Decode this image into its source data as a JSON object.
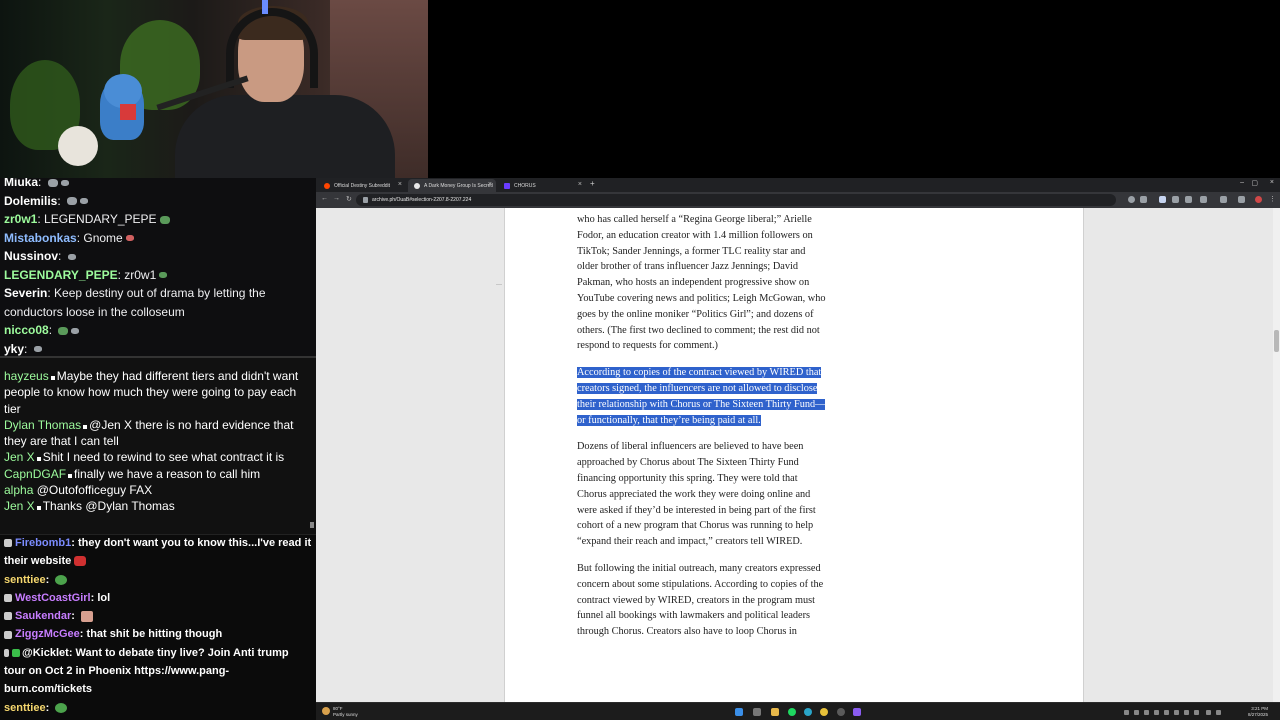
{
  "chat_top": [
    {
      "user": "Miuka",
      "text": "",
      "color": "#ffffff"
    },
    {
      "user": "Dolemilis",
      "text": "",
      "color": "#ffffff"
    },
    {
      "user": "zr0w1",
      "text": "LEGENDARY_PEPE",
      "color": "#9dfc9d"
    },
    {
      "user": "Mistabonkas",
      "text": "Gnome",
      "color": "#8fbcff"
    },
    {
      "user": "Nussinov",
      "text": "",
      "color": "#ffffff"
    },
    {
      "user": "LEGENDARY_PEPE",
      "text": "zr0w1",
      "color": "#9dfc9d"
    },
    {
      "user": "Severin",
      "text": "Keep destiny out of drama by letting the conductors loose in the colloseum",
      "color": "#ffffff"
    },
    {
      "user": "nicco08",
      "text": "",
      "color": "#9dfc9d"
    },
    {
      "user": "yky",
      "text": "",
      "color": "#ffffff"
    }
  ],
  "chat_mid": [
    {
      "user": "hayzeus",
      "text": "Maybe they had different tiers and didn't want people to know how much they were going to pay each tier",
      "color": "#9dfc9d"
    },
    {
      "user": "Dylan Thomas",
      "text": "@Jen X there is no hard evidence that they are that I can tell",
      "color": "#9dfc9d"
    },
    {
      "user": "Jen X",
      "text": "Shit I need to rewind to see what contract it is",
      "color": "#9dfc9d"
    },
    {
      "user": "CapnDGAF",
      "text": "finally we have a reason to call him",
      "color": "#9dfc9d"
    },
    {
      "user": "alpha",
      "text": "@Outofofficeguy FAX",
      "color": "#9dfc9d"
    },
    {
      "user": "Jen X",
      "text": "Thanks @Dylan Thomas",
      "color": "#9dfc9d"
    }
  ],
  "chat_bot": [
    {
      "user": "Firebomb1",
      "text": "they don't want you to know this...I've read it their website",
      "color": "#7b8cff"
    },
    {
      "user": "senttiee",
      "text": "",
      "color": "#f5d76e"
    },
    {
      "user": "WestCoastGirl",
      "text": "lol",
      "color": "#c77dff"
    },
    {
      "user": "Saukendar",
      "text": "",
      "color": "#c77dff"
    },
    {
      "user": "ZiggzMcGee",
      "text": "that shit be hitting though",
      "color": "#c77dff"
    },
    {
      "user": "@Kicklet",
      "text": "Want to debate tiny live? Join Anti trump tour on Oct 2 in Phoenix https://www.pang-burn.com/tickets",
      "color": "#ffffff"
    },
    {
      "user": "senttiee",
      "text": "",
      "color": "#f5d76e"
    }
  ],
  "browser": {
    "tabs": [
      {
        "label": "Official Destiny Subreddit",
        "color": "#ff4500"
      },
      {
        "label": "A Dark Money Group Is Secretl",
        "color": "#e8e8e8"
      },
      {
        "label": "CHORUS",
        "color": "#6a3cff"
      }
    ],
    "url": "archive.ph/OuaB#selection-2207.8-2207.224",
    "article": [
      {
        "text": "who has called herself a “Regina George liberal;” Arielle Fodor, an education creator with 1.4 million followers on TikTok; Sander Jennings, a former TLC reality star and older brother of trans influencer Jazz Jennings; David Pakman, who hosts an independent progressive show on YouTube covering news and politics; Leigh McGowan, who goes by the online moniker “Politics Girl”; and dozens of others. (The first two declined to comment; the rest did not respond to requests for comment.)",
        "highlighted": false
      },
      {
        "text": "According to copies of the contract viewed by WIRED that creators signed, the influencers are not allowed to disclose their relationship with Chorus or The Sixteen Thirty Fund—or functionally, that they’re being paid at all.",
        "highlighted": true
      },
      {
        "text": "Dozens of liberal influencers are believed to have been approached by Chorus about The Sixteen Thirty Fund financing opportunity this spring. They were told that Chorus appreciated the work they were doing online and were asked if they’d be interested in being part of the first cohort of a new program that Chorus was running to help “expand their reach and impact,” creators tell WIRED.",
        "highlighted": false
      },
      {
        "text": "But following the initial outreach, many creators expressed concern about some stipulations. According to copies of the contract viewed by WIRED, creators in the program must funnel all bookings with lawmakers and political leaders through Chorus. Creators also have to loop Chorus in",
        "highlighted": false
      }
    ]
  },
  "taskbar": {
    "weather_temp": "80°F",
    "weather_desc": "Partly sunny",
    "time": "3:21 PM",
    "date": "8/27/2025"
  }
}
